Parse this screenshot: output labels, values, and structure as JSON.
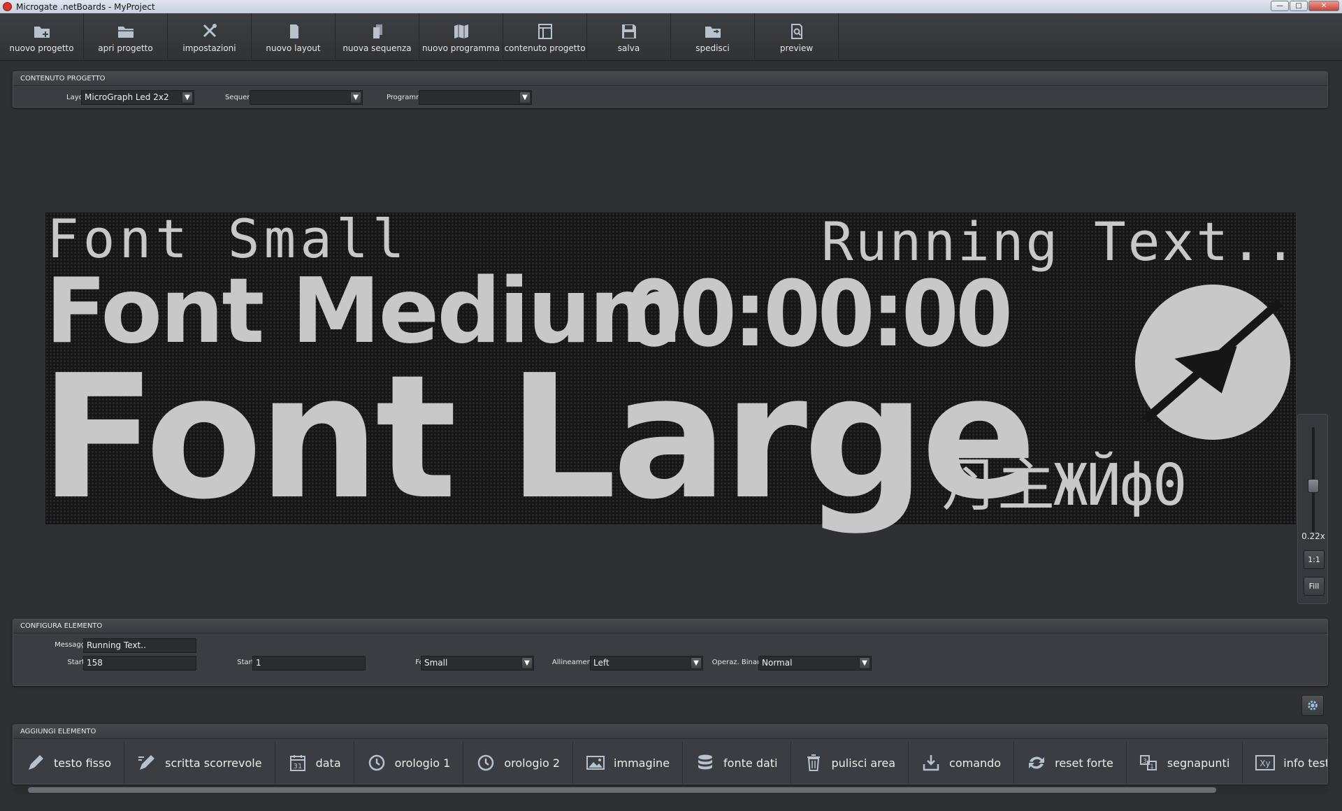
{
  "window": {
    "title": "Microgate .netBoards - MyProject",
    "min_icon": "minimize-icon",
    "max_icon": "maximize-icon",
    "close_icon": "close-icon"
  },
  "toolbar": [
    {
      "label": "nuovo progetto",
      "icon": "folder-plus-icon"
    },
    {
      "label": "apri progetto",
      "icon": "folder-open-icon"
    },
    {
      "label": "impostazioni",
      "icon": "tools-icon"
    },
    {
      "label": "nuovo layout",
      "icon": "page-icon"
    },
    {
      "label": "nuova sequenza",
      "icon": "pages-icon"
    },
    {
      "label": "nuovo programma",
      "icon": "map-icon"
    },
    {
      "label": "contenuto progetto",
      "icon": "layout-icon"
    },
    {
      "label": "salva",
      "icon": "save-icon"
    },
    {
      "label": "spedisci",
      "icon": "folder-send-icon"
    },
    {
      "label": "preview",
      "icon": "preview-icon"
    }
  ],
  "project_panel": {
    "title": "CONTENUTO PROGETTO",
    "layout_label": "Layout",
    "layout_value": "MicroGraph Led 2x2",
    "sequence_label": "Sequenza",
    "sequence_value": "",
    "program_label": "Programma",
    "program_value": ""
  },
  "led_board": {
    "font_small": "Font Small",
    "running_text": "Running Text..",
    "font_medium": "Font Medium",
    "clock": "00:00:00",
    "font_large": "Font Large",
    "glyphs": "丹主ЖЙф0",
    "logo_icon": "microgate-logo-icon"
  },
  "zoom": {
    "level": "0.22x",
    "one_to_one": "1:1",
    "fill": "Fill"
  },
  "config_panel": {
    "title": "CONFIGURA ELEMENTO",
    "message_label": "Messaggio",
    "message_value": "Running Text..",
    "startx_label": "Start X",
    "startx_value": "158",
    "starty_label": "Start Y",
    "starty_value": "1",
    "font_label": "Font",
    "font_value": "Small",
    "align_label": "Allineamento",
    "align_value": "Left",
    "binop_label": "Operaz. Binaria",
    "binop_value": "Normal"
  },
  "add_panel": {
    "title": "AGGIUNGI ELEMENTO",
    "items": [
      {
        "label": "testo fisso",
        "icon": "pencil-icon"
      },
      {
        "label": "scritta scorrevole",
        "icon": "pencil-scroll-icon"
      },
      {
        "label": "data",
        "icon": "calendar-icon"
      },
      {
        "label": "orologio 1",
        "icon": "clock-icon"
      },
      {
        "label": "orologio 2",
        "icon": "clock-icon"
      },
      {
        "label": "immagine",
        "icon": "image-icon"
      },
      {
        "label": "fonte dati",
        "icon": "database-icon"
      },
      {
        "label": "pulisci area",
        "icon": "trash-icon"
      },
      {
        "label": "comando",
        "icon": "download-icon"
      },
      {
        "label": "reset forte",
        "icon": "refresh-icon"
      },
      {
        "label": "segnapunti",
        "icon": "scoreboard-icon"
      },
      {
        "label": "info testua",
        "icon": "text-info-icon"
      }
    ]
  },
  "colors": {
    "background": "#2e3033",
    "panel": "#3a3d41",
    "led_on": "#c8c8c8",
    "led_bg": "#161616"
  }
}
